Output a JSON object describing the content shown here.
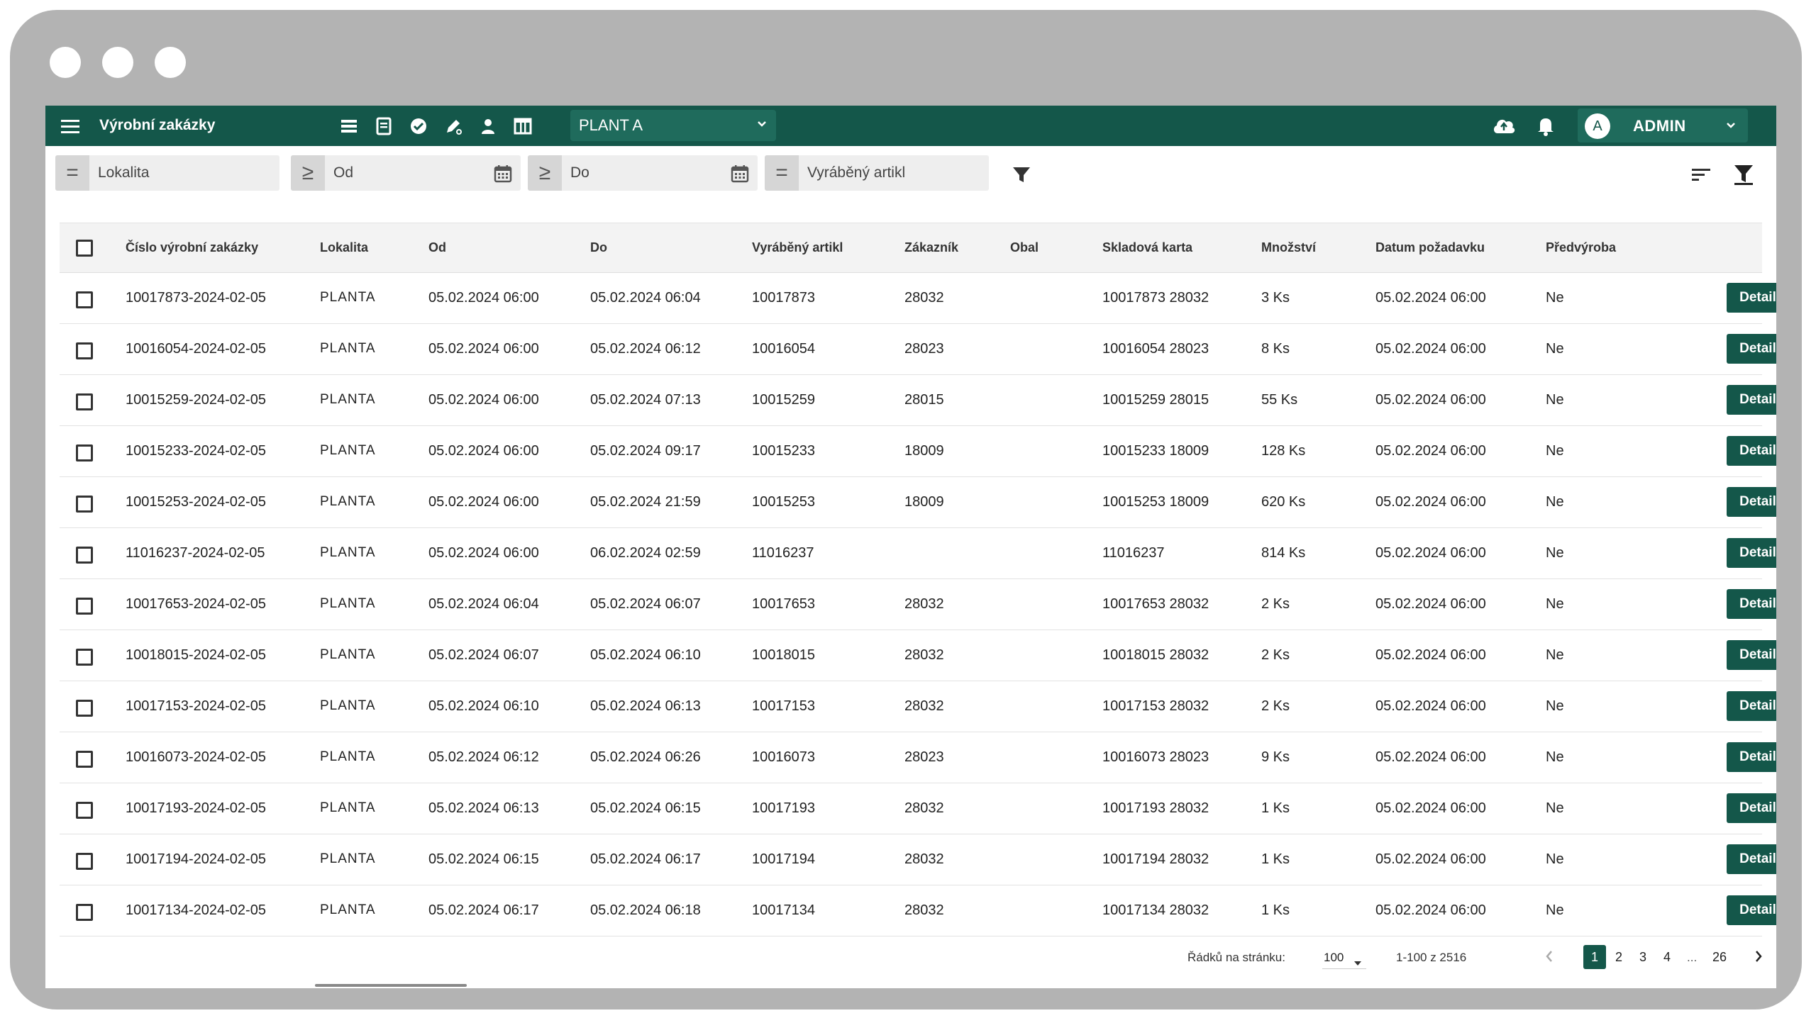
{
  "window": {
    "dots": [
      "close",
      "minimize",
      "maximize"
    ]
  },
  "topbar": {
    "title": "Výrobní zakázky",
    "plant": "PLANT A",
    "user_initial": "A",
    "user_name": "ADMIN",
    "icons": [
      "list-icon",
      "document-icon",
      "check-circle-icon",
      "pen-icon",
      "person-icon",
      "table-icon"
    ]
  },
  "filters": {
    "lokalita": {
      "op": "=",
      "placeholder": "Lokalita"
    },
    "od": {
      "op": "≥",
      "placeholder": "Od"
    },
    "do": {
      "op": "≥",
      "placeholder": "Do"
    },
    "artikl": {
      "op": "=",
      "placeholder": "Vyráběný artikl"
    }
  },
  "table": {
    "headers": {
      "cislo": "Číslo výrobní zakázky",
      "lokalita": "Lokalita",
      "od": "Od",
      "do": "Do",
      "artikl": "Vyráběný artikl",
      "zakaznik": "Zákazník",
      "obal": "Obal",
      "karta": "Skladová karta",
      "mnozstvi": "Množství",
      "datum": "Datum požadavku",
      "predvyroba": "Předvýroba"
    },
    "detail_label": "Detail",
    "rows": [
      {
        "cislo": "10017873-2024-02-05",
        "lokalita": "PLANTA",
        "od": "05.02.2024 06:00",
        "do": "05.02.2024 06:04",
        "artikl": "10017873",
        "zakaznik": "28032",
        "obal": "",
        "karta": "10017873 28032",
        "mnozstvi": "3 Ks",
        "datum": "05.02.2024 06:00",
        "predvyroba": "Ne"
      },
      {
        "cislo": "10016054-2024-02-05",
        "lokalita": "PLANTA",
        "od": "05.02.2024 06:00",
        "do": "05.02.2024 06:12",
        "artikl": "10016054",
        "zakaznik": "28023",
        "obal": "",
        "karta": "10016054 28023",
        "mnozstvi": "8 Ks",
        "datum": "05.02.2024 06:00",
        "predvyroba": "Ne"
      },
      {
        "cislo": "10015259-2024-02-05",
        "lokalita": "PLANTA",
        "od": "05.02.2024 06:00",
        "do": "05.02.2024 07:13",
        "artikl": "10015259",
        "zakaznik": "28015",
        "obal": "",
        "karta": "10015259 28015",
        "mnozstvi": "55 Ks",
        "datum": "05.02.2024 06:00",
        "predvyroba": "Ne"
      },
      {
        "cislo": "10015233-2024-02-05",
        "lokalita": "PLANTA",
        "od": "05.02.2024 06:00",
        "do": "05.02.2024 09:17",
        "artikl": "10015233",
        "zakaznik": "18009",
        "obal": "",
        "karta": "10015233 18009",
        "mnozstvi": "128 Ks",
        "datum": "05.02.2024 06:00",
        "predvyroba": "Ne"
      },
      {
        "cislo": "10015253-2024-02-05",
        "lokalita": "PLANTA",
        "od": "05.02.2024 06:00",
        "do": "05.02.2024 21:59",
        "artikl": "10015253",
        "zakaznik": "18009",
        "obal": "",
        "karta": "10015253 18009",
        "mnozstvi": "620 Ks",
        "datum": "05.02.2024 06:00",
        "predvyroba": "Ne"
      },
      {
        "cislo": "11016237-2024-02-05",
        "lokalita": "PLANTA",
        "od": "05.02.2024 06:00",
        "do": "06.02.2024 02:59",
        "artikl": "11016237",
        "zakaznik": "",
        "obal": "",
        "karta": "11016237",
        "mnozstvi": "814 Ks",
        "datum": "05.02.2024 06:00",
        "predvyroba": "Ne"
      },
      {
        "cislo": "10017653-2024-02-05",
        "lokalita": "PLANTA",
        "od": "05.02.2024 06:04",
        "do": "05.02.2024 06:07",
        "artikl": "10017653",
        "zakaznik": "28032",
        "obal": "",
        "karta": "10017653 28032",
        "mnozstvi": "2 Ks",
        "datum": "05.02.2024 06:00",
        "predvyroba": "Ne"
      },
      {
        "cislo": "10018015-2024-02-05",
        "lokalita": "PLANTA",
        "od": "05.02.2024 06:07",
        "do": "05.02.2024 06:10",
        "artikl": "10018015",
        "zakaznik": "28032",
        "obal": "",
        "karta": "10018015 28032",
        "mnozstvi": "2 Ks",
        "datum": "05.02.2024 06:00",
        "predvyroba": "Ne"
      },
      {
        "cislo": "10017153-2024-02-05",
        "lokalita": "PLANTA",
        "od": "05.02.2024 06:10",
        "do": "05.02.2024 06:13",
        "artikl": "10017153",
        "zakaznik": "28032",
        "obal": "",
        "karta": "10017153 28032",
        "mnozstvi": "2 Ks",
        "datum": "05.02.2024 06:00",
        "predvyroba": "Ne"
      },
      {
        "cislo": "10016073-2024-02-05",
        "lokalita": "PLANTA",
        "od": "05.02.2024 06:12",
        "do": "05.02.2024 06:26",
        "artikl": "10016073",
        "zakaznik": "28023",
        "obal": "",
        "karta": "10016073 28023",
        "mnozstvi": "9 Ks",
        "datum": "05.02.2024 06:00",
        "predvyroba": "Ne"
      },
      {
        "cislo": "10017193-2024-02-05",
        "lokalita": "PLANTA",
        "od": "05.02.2024 06:13",
        "do": "05.02.2024 06:15",
        "artikl": "10017193",
        "zakaznik": "28032",
        "obal": "",
        "karta": "10017193 28032",
        "mnozstvi": "1 Ks",
        "datum": "05.02.2024 06:00",
        "predvyroba": "Ne"
      },
      {
        "cislo": "10017194-2024-02-05",
        "lokalita": "PLANTA",
        "od": "05.02.2024 06:15",
        "do": "05.02.2024 06:17",
        "artikl": "10017194",
        "zakaznik": "28032",
        "obal": "",
        "karta": "10017194 28032",
        "mnozstvi": "1 Ks",
        "datum": "05.02.2024 06:00",
        "predvyroba": "Ne"
      },
      {
        "cislo": "10017134-2024-02-05",
        "lokalita": "PLANTA",
        "od": "05.02.2024 06:17",
        "do": "05.02.2024 06:18",
        "artikl": "10017134",
        "zakaznik": "28032",
        "obal": "",
        "karta": "10017134 28032",
        "mnozstvi": "1 Ks",
        "datum": "05.02.2024 06:00",
        "predvyroba": "Ne"
      }
    ]
  },
  "pagination": {
    "rows_label": "Řádků na stránku:",
    "rows_value": "100",
    "range": "1-100 z 2516",
    "pages": [
      "1",
      "2",
      "3",
      "4"
    ],
    "ellipsis": "...",
    "last_page": "26",
    "current": "1"
  },
  "colors": {
    "primary": "#14574a",
    "frame": "#b3b3b3"
  }
}
